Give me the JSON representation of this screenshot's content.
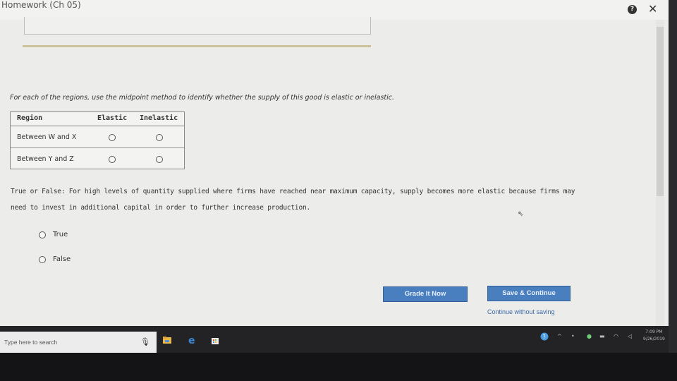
{
  "window": {
    "title": "Homework (Ch 05)",
    "help_glyph": "?",
    "close_glyph": "✕"
  },
  "instruction": "For each of the regions, use the midpoint method to identify whether the supply of this good is elastic or inelastic.",
  "table": {
    "headers": [
      "Region",
      "Elastic",
      "Inelastic"
    ],
    "rows": [
      {
        "label": "Between W and X",
        "elastic_selected": false,
        "inelastic_selected": false
      },
      {
        "label": "Between Y and Z",
        "elastic_selected": false,
        "inelastic_selected": false
      }
    ]
  },
  "question": {
    "line1": "True or False: For high levels of quantity supplied where firms have reached near maximum capacity, supply becomes more elastic because firms may",
    "line2": "need to invest in additional capital in order to further increase production.",
    "options": [
      "True",
      "False"
    ]
  },
  "buttons": {
    "grade": "Grade It Now",
    "save": "Save & Continue",
    "continue_link": "Continue without saving"
  },
  "taskbar": {
    "search_placeholder": "Type here to search",
    "icons": [
      "mic-icon",
      "file-explorer-icon",
      "edge-icon",
      "store-icon"
    ],
    "tray_icons": [
      "help-icon",
      "chevron-up-icon",
      "network-icon",
      "battery-icon",
      "volume-icon"
    ],
    "time": "7:09 PM",
    "date": "9/26/2019"
  },
  "colors": {
    "button_blue": "#4a7fbf",
    "link_blue": "#3b6aa6",
    "page_bg": "#ececea"
  }
}
